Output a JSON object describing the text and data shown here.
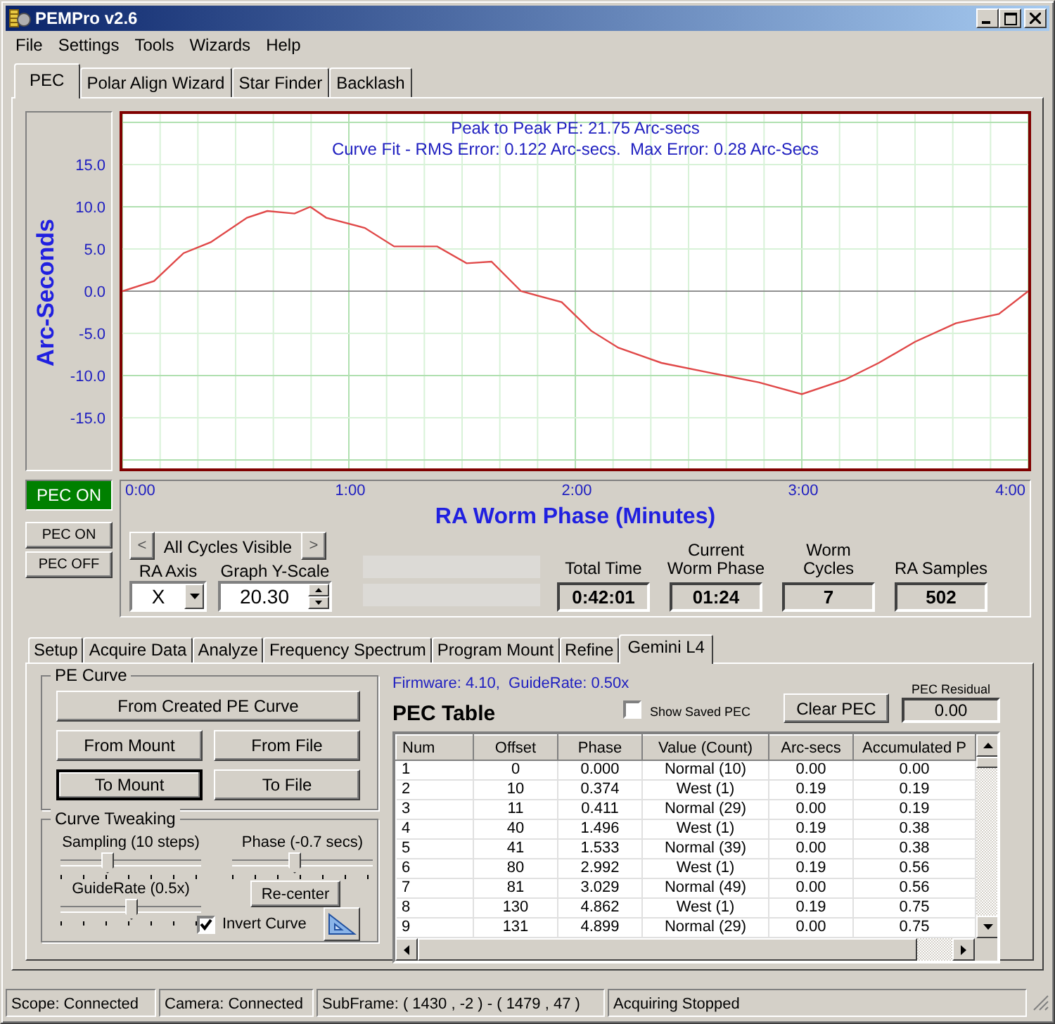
{
  "window": {
    "title": "PEMPro v2.6"
  },
  "menu": [
    "File",
    "Settings",
    "Tools",
    "Wizards",
    "Help"
  ],
  "tabs": [
    {
      "label": "PEC",
      "selected": true
    },
    {
      "label": "Polar Align Wizard",
      "selected": false
    },
    {
      "label": "Star Finder",
      "selected": false
    },
    {
      "label": "Backlash",
      "selected": false
    }
  ],
  "graph": {
    "header": [
      "Peak to Peak PE: 21.75 Arc-secs",
      "Curve Fit - RMS Error: 0.122 Arc-secs.  Max Error: 0.28 Arc-Secs"
    ],
    "chart_data": {
      "type": "line",
      "xlabel": "RA Worm Phase (Minutes)",
      "ylabel": "Arc-Seconds",
      "x": [
        0,
        0.14,
        0.27,
        0.39,
        0.55,
        0.64,
        0.76,
        0.83,
        0.9,
        1.07,
        1.2,
        1.39,
        1.52,
        1.63,
        1.76,
        1.94,
        2.07,
        2.19,
        2.38,
        2.6,
        2.81,
        3.0,
        3.19,
        3.34,
        3.5,
        3.68,
        3.87,
        4.0
      ],
      "series": [
        {
          "color": "#e04848",
          "values": [
            0,
            1.2,
            4.5,
            5.8,
            8.7,
            9.5,
            9.2,
            10,
            8.7,
            7.5,
            5.3,
            5.3,
            3.3,
            3.5,
            0,
            -1.3,
            -4.7,
            -6.7,
            -8.5,
            -9.7,
            -10.8,
            -12.2,
            -10.5,
            -8.5,
            -6,
            -3.8,
            -2.7,
            0
          ]
        }
      ],
      "xlim": [
        0,
        4
      ],
      "ylim": [
        -21,
        21
      ],
      "grid": true,
      "xticks": [
        {
          "value": 0,
          "label": "0:00"
        },
        {
          "value": 1,
          "label": "1:00"
        },
        {
          "value": 2,
          "label": "2:00"
        },
        {
          "value": 3,
          "label": "3:00"
        },
        {
          "value": 4,
          "label": "4:00"
        }
      ],
      "yticks": [
        {
          "value": 15,
          "label": "15.0"
        },
        {
          "value": 10,
          "label": "10.0"
        },
        {
          "value": 5,
          "label": "5.0"
        },
        {
          "value": 0,
          "label": "0.0"
        },
        {
          "value": -5,
          "label": "-5.0"
        },
        {
          "value": -10,
          "label": "-10.0"
        },
        {
          "value": -15,
          "label": "-15.0"
        }
      ]
    }
  },
  "pec_indicator": {
    "label": "PEC ON",
    "on": true
  },
  "pec_buttons": [
    "PEC ON",
    "PEC OFF"
  ],
  "cycles": {
    "prev": "<",
    "label": "All Cycles Visible",
    "next": ">"
  },
  "ra_axis": {
    "label": "RA Axis",
    "value": "X"
  },
  "y_scale": {
    "label": "Graph Y-Scale",
    "value": "20.30"
  },
  "stats": [
    {
      "label": "Total Time",
      "value": "0:42:01"
    },
    {
      "label": "Current Worm Phase",
      "value": "01:24"
    },
    {
      "label": "Worm Cycles",
      "value": "7"
    },
    {
      "label": "RA Samples",
      "value": "502"
    }
  ],
  "lower_tabs": [
    {
      "label": "Setup",
      "selected": false
    },
    {
      "label": "Acquire Data",
      "selected": false
    },
    {
      "label": "Analyze",
      "selected": false
    },
    {
      "label": "Frequency Spectrum",
      "selected": false
    },
    {
      "label": "Program Mount",
      "selected": false
    },
    {
      "label": "Refine",
      "selected": false
    },
    {
      "label": "Gemini L4",
      "selected": true
    }
  ],
  "pe_curve": {
    "title": "PE Curve",
    "buttons": [
      {
        "label": "From Created PE Curve",
        "default": false
      },
      {
        "label": "From Mount",
        "default": false
      },
      {
        "label": "From File",
        "default": false
      },
      {
        "label": "To Mount",
        "default": true
      },
      {
        "label": "To File",
        "default": false
      }
    ]
  },
  "curve_tweaking": {
    "title": "Curve Tweaking",
    "sliders": [
      {
        "label": "Sampling (10 steps)",
        "level": 0.33
      },
      {
        "label": "Phase (-0.7 secs)",
        "level": 0.44
      },
      {
        "label": "GuideRate (0.5x)",
        "level": 0.5
      }
    ],
    "recenter": "Re-center",
    "invert": {
      "label": "Invert Curve",
      "checked": true
    }
  },
  "firmware": "Firmware: 4.10,  GuideRate: 0.50x",
  "pec_table": {
    "title": "PEC Table",
    "show_saved": {
      "label": "Show Saved PEC",
      "checked": false
    },
    "clear": "Clear PEC",
    "residual": {
      "label": "PEC Residual",
      "value": "0.00"
    },
    "columns": [
      "Num",
      "Offset",
      "Phase",
      "Value (Count)",
      "Arc-secs",
      "Accumulated P"
    ],
    "rows": [
      [
        "1",
        "0",
        "0.000",
        "Normal (10)",
        "0.00",
        "0.00"
      ],
      [
        "2",
        "10",
        "0.374",
        "West (1)",
        "0.19",
        "0.19"
      ],
      [
        "3",
        "11",
        "0.411",
        "Normal (29)",
        "0.00",
        "0.19"
      ],
      [
        "4",
        "40",
        "1.496",
        "West (1)",
        "0.19",
        "0.38"
      ],
      [
        "5",
        "41",
        "1.533",
        "Normal (39)",
        "0.00",
        "0.38"
      ],
      [
        "6",
        "80",
        "2.992",
        "West (1)",
        "0.19",
        "0.56"
      ],
      [
        "7",
        "81",
        "3.029",
        "Normal (49)",
        "0.00",
        "0.56"
      ],
      [
        "8",
        "130",
        "4.862",
        "West (1)",
        "0.19",
        "0.75"
      ],
      [
        "9",
        "131",
        "4.899",
        "Normal (29)",
        "0.00",
        "0.75"
      ]
    ]
  },
  "status_bar": [
    "Scope: Connected",
    "Camera: Connected",
    "SubFrame: ( 1430 , -2 ) - ( 1479 , 47 )",
    "Acquiring Stopped"
  ]
}
